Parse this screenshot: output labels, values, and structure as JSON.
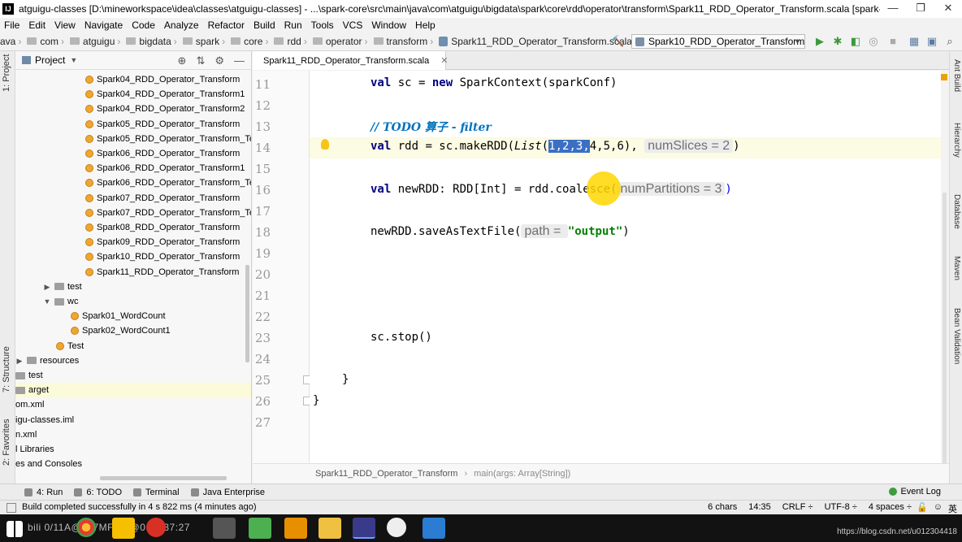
{
  "window": {
    "title": "atguigu-classes [D:\\mineworkspace\\idea\\classes\\atguigu-classes] - ...\\spark-core\\src\\main\\java\\com\\atguigu\\bigdata\\spark\\core\\rdd\\operator\\transform\\Spark11_RDD_Operator_Transform.scala [spark-c...",
    "app_icon": "IJ",
    "minimize": "—",
    "restore": "❐",
    "close": "✕"
  },
  "menu": [
    "File",
    "Edit",
    "View",
    "Navigate",
    "Code",
    "Analyze",
    "Refactor",
    "Build",
    "Run",
    "Tools",
    "VCS",
    "Window",
    "Help"
  ],
  "navbar": {
    "crumbs": [
      "ava",
      "com",
      "atguigu",
      "bigdata",
      "spark",
      "core",
      "rdd",
      "operator",
      "transform"
    ],
    "file": "Spark11_RDD_Operator_Transform.scala",
    "run_config": "Spark10_RDD_Operator_Transform"
  },
  "left_strip": {
    "project": "1: Project",
    "structure": "7: Structure",
    "favorites": "2: Favorites"
  },
  "project_panel": {
    "title": "Project",
    "items": [
      {
        "label": "Spark04_RDD_Operator_Transform",
        "kind": "object"
      },
      {
        "label": "Spark04_RDD_Operator_Transform1",
        "kind": "object"
      },
      {
        "label": "Spark04_RDD_Operator_Transform2",
        "kind": "object"
      },
      {
        "label": "Spark05_RDD_Operator_Transform",
        "kind": "object"
      },
      {
        "label": "Spark05_RDD_Operator_Transform_Te",
        "kind": "object"
      },
      {
        "label": "Spark06_RDD_Operator_Transform",
        "kind": "object"
      },
      {
        "label": "Spark06_RDD_Operator_Transform1",
        "kind": "object"
      },
      {
        "label": "Spark06_RDD_Operator_Transform_Te",
        "kind": "object"
      },
      {
        "label": "Spark07_RDD_Operator_Transform",
        "kind": "object"
      },
      {
        "label": "Spark07_RDD_Operator_Transform_Te",
        "kind": "object"
      },
      {
        "label": "Spark08_RDD_Operator_Transform",
        "kind": "object"
      },
      {
        "label": "Spark09_RDD_Operator_Transform",
        "kind": "object"
      },
      {
        "label": "Spark10_RDD_Operator_Transform",
        "kind": "object"
      },
      {
        "label": "Spark11_RDD_Operator_Transform",
        "kind": "object"
      },
      {
        "label": "test",
        "kind": "folder-collapsed"
      },
      {
        "label": "wc",
        "kind": "folder-expanded"
      },
      {
        "label": "Spark01_WordCount",
        "kind": "object"
      },
      {
        "label": "Spark02_WordCount1",
        "kind": "object"
      },
      {
        "label": "Test",
        "kind": "object"
      },
      {
        "label": "resources",
        "kind": "folder-collapsed"
      },
      {
        "label": "test",
        "kind": "folder"
      },
      {
        "label": "arget",
        "kind": "folder-selected"
      },
      {
        "label": "om.xml",
        "kind": "file"
      },
      {
        "label": "igu-classes.iml",
        "kind": "file"
      },
      {
        "label": "n.xml",
        "kind": "file"
      },
      {
        "label": "l Libraries",
        "kind": "file"
      },
      {
        "label": "es and Consoles",
        "kind": "file"
      }
    ]
  },
  "editor": {
    "tab": "Spark11_RDD_Operator_Transform.scala",
    "line_numbers": [
      "11",
      "12",
      "13",
      "14",
      "15",
      "16",
      "17",
      "18",
      "19",
      "20",
      "21",
      "22",
      "23",
      "24",
      "25",
      "26",
      "27"
    ],
    "code": {
      "l11_kw": "val",
      "l11_rest": " sc = ",
      "l11_new": "new",
      "l11_tail": " SparkContext(sparkConf)",
      "l13": "// TODO 算子 - filter",
      "l14_kw": "val",
      "l14_a": " rdd = sc.makeRDD(",
      "l14_list": "List",
      "l14_p": "(",
      "l14_sel": "1,2,3,",
      "l14_b": "4,5,6),",
      "l14_hint": "numSlices = 2",
      "l14_end": ")",
      "l16_kw": "val",
      "l16_a": " newRDD: RDD[Int] = rdd.coalesce(",
      "l16_hint": "numPartitions = 3",
      "l16_end": ")",
      "l18_a": "newRDD.saveAsTextFile(",
      "l18_hint": "path = ",
      "l18_str": "\"output\"",
      "l18_end": ")",
      "l23": "sc.stop()",
      "l25": "}",
      "l26": "}"
    },
    "breadcrumb_object": "Spark11_RDD_Operator_Transform",
    "breadcrumb_method": "main(args: Array[String])"
  },
  "right_strip": [
    "Ant Build",
    "Hierarchy",
    "Database",
    "Maven",
    "Bean Validation"
  ],
  "tool_windows": [
    {
      "label": "4: Run"
    },
    {
      "label": "6: TODO"
    },
    {
      "label": "Terminal"
    },
    {
      "label": "Java Enterprise"
    }
  ],
  "event_log": "Event Log",
  "status": {
    "message": "Build completed successfully in 4 s 822 ms (4 minutes ago)",
    "chars": "6 chars",
    "position": "14:35",
    "line_sep": "CRLF ÷",
    "encoding": "UTF-8 ÷",
    "indent": "4 spaces ÷"
  },
  "taskbar": {
    "overlay": "bili 0/11A@1L7MF P5@0:52:37:27",
    "watermark": "https://blog.csdn.net/u012304418"
  },
  "colors": {
    "keyword": "#000080",
    "comment": "#0073bf",
    "string": "#008000",
    "selection": "#3a6fc4",
    "cursor_highlight": "#ffd600"
  }
}
